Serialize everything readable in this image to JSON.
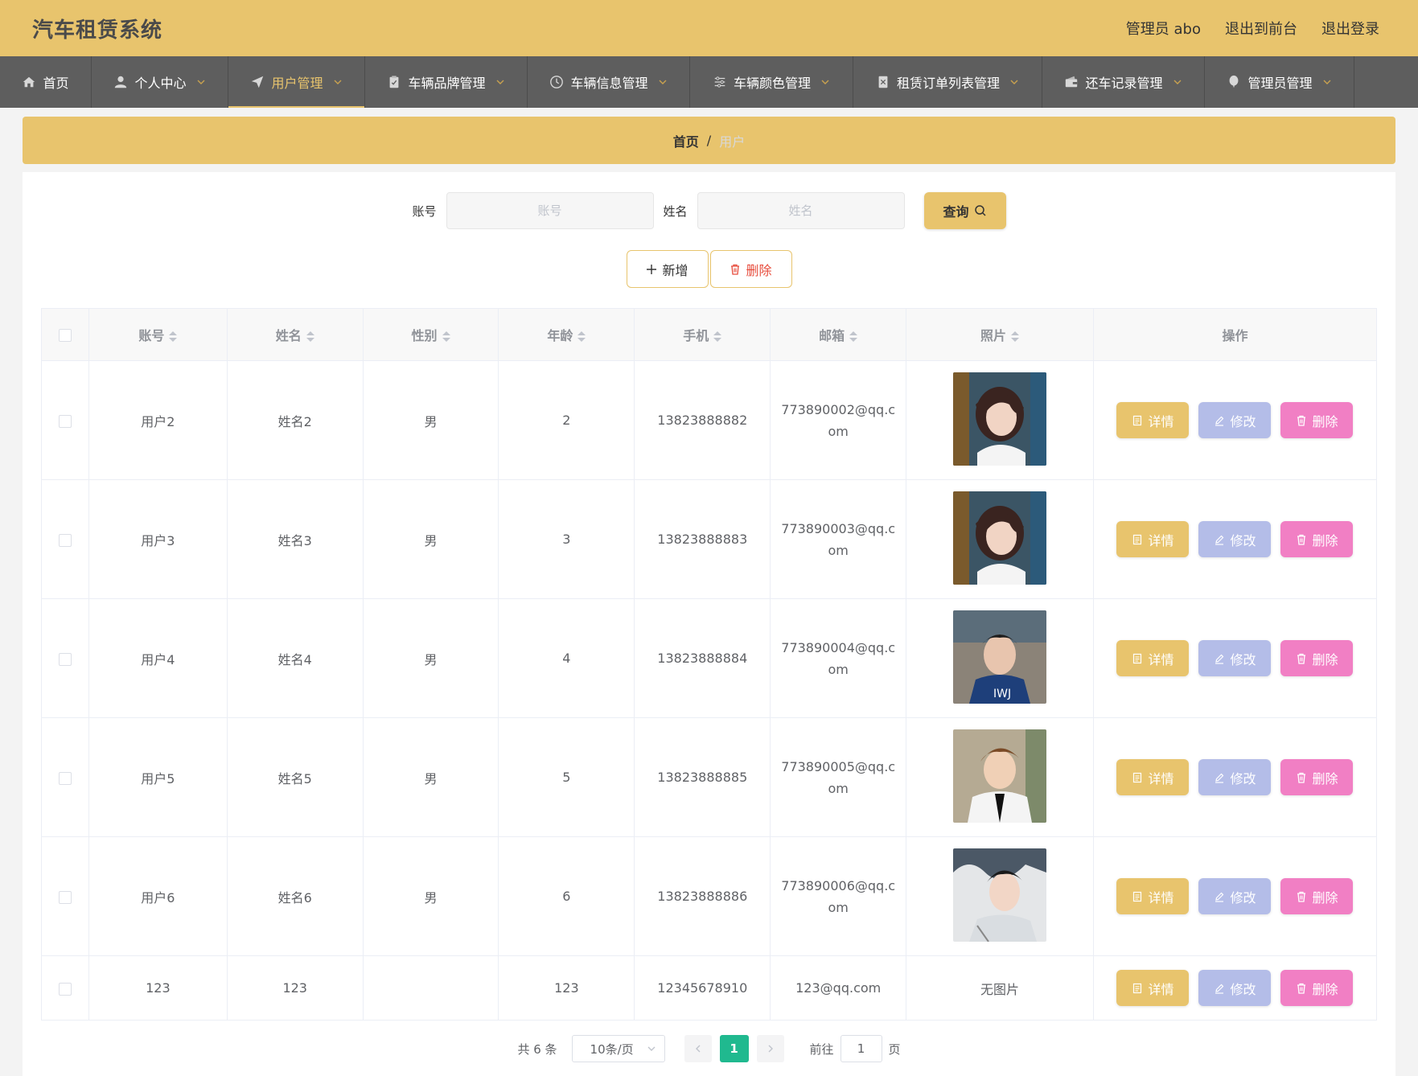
{
  "header": {
    "title": "汽车租赁系统",
    "admin_label": "管理员 abo",
    "front_link": "退出到前台",
    "logout_link": "退出登录"
  },
  "nav": {
    "items": [
      {
        "label": "首页",
        "icon": "home-icon",
        "dropdown": false
      },
      {
        "label": "个人中心",
        "icon": "user-icon",
        "dropdown": true
      },
      {
        "label": "用户管理",
        "icon": "send-icon",
        "dropdown": true,
        "active": true
      },
      {
        "label": "车辆品牌管理",
        "icon": "clipboard-icon",
        "dropdown": true
      },
      {
        "label": "车辆信息管理",
        "icon": "clock-icon",
        "dropdown": true
      },
      {
        "label": "车辆颜色管理",
        "icon": "sliders-icon",
        "dropdown": true
      },
      {
        "label": "租赁订单列表管理",
        "icon": "document-icon",
        "dropdown": true
      },
      {
        "label": "还车记录管理",
        "icon": "wallet-icon",
        "dropdown": true
      },
      {
        "label": "管理员管理",
        "icon": "balloon-icon",
        "dropdown": true
      }
    ]
  },
  "breadcrumb": {
    "home": "首页",
    "separator": "/",
    "current": "用户"
  },
  "search": {
    "account_label": "账号",
    "account_placeholder": "账号",
    "name_label": "姓名",
    "name_placeholder": "姓名",
    "query_button": "查询"
  },
  "actions": {
    "add_button": "新增",
    "delete_button": "删除"
  },
  "table": {
    "headers": [
      "账号",
      "姓名",
      "性别",
      "年龄",
      "手机",
      "邮箱",
      "照片",
      "操作"
    ],
    "op_labels": {
      "detail": "详情",
      "edit": "修改",
      "delete": "删除"
    },
    "rows": [
      {
        "account": "用户2",
        "name": "姓名2",
        "gender": "男",
        "age": "2",
        "phone": "13823888882",
        "email": "773890002@qq.com",
        "photo": "female-portrait"
      },
      {
        "account": "用户3",
        "name": "姓名3",
        "gender": "男",
        "age": "3",
        "phone": "13823888883",
        "email": "773890003@qq.com",
        "photo": "female-portrait"
      },
      {
        "account": "用户4",
        "name": "姓名4",
        "gender": "男",
        "age": "4",
        "phone": "13823888884",
        "email": "773890004@qq.com",
        "photo": "male-portrait"
      },
      {
        "account": "用户5",
        "name": "姓名5",
        "gender": "男",
        "age": "5",
        "phone": "13823888885",
        "email": "773890005@qq.com",
        "photo": "male-portrait"
      },
      {
        "account": "用户6",
        "name": "姓名6",
        "gender": "男",
        "age": "6",
        "phone": "13823888886",
        "email": "773890006@qq.com",
        "photo": "male-portrait"
      },
      {
        "account": "123",
        "name": "123",
        "gender": "",
        "age": "123",
        "phone": "12345678910",
        "email": "123@qq.com",
        "photo": "无图片"
      }
    ]
  },
  "pagination": {
    "total": "共 6 条",
    "page_size": "10条/页",
    "current_page": "1",
    "goto_prefix": "前往",
    "goto_value": "1",
    "goto_suffix": "页"
  },
  "colors": {
    "accent": "#e8c46d",
    "nav_bg": "#5e5e5e",
    "edit": "#b4bde8",
    "delete": "#f17fc4",
    "page_active": "#20b98f"
  }
}
